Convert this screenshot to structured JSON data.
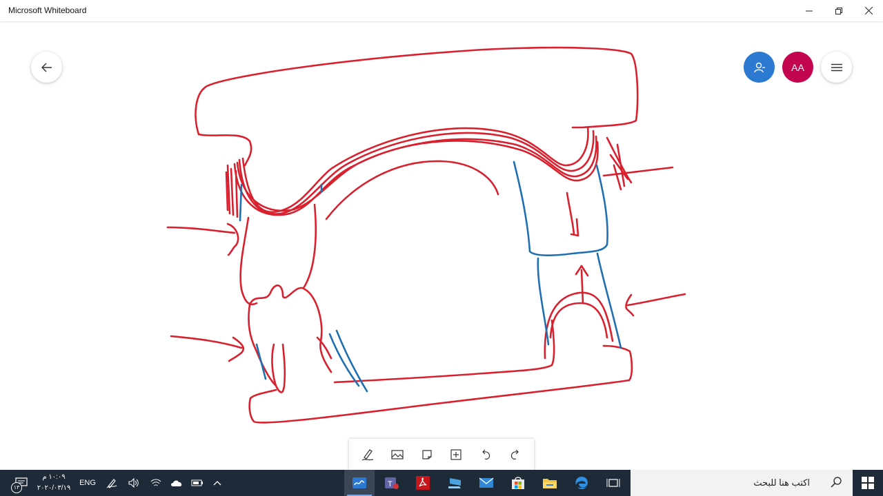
{
  "window": {
    "title": "Microsoft Whiteboard"
  },
  "titlebar_buttons": {
    "minimize": "minimize-icon",
    "restore": "restore-icon",
    "close": "close-icon"
  },
  "header": {
    "avatar_initials": "AA"
  },
  "colors": {
    "ink_red": "#d8202e",
    "ink_blue": "#1f6fb3",
    "avatar": "#c3054f",
    "share": "#2b79d0",
    "taskbar": "#1f2a38"
  },
  "toolbar": {
    "tools": [
      "pen-icon",
      "image-icon",
      "note-icon",
      "add-icon",
      "undo-icon",
      "redo-icon"
    ]
  },
  "taskbar": {
    "time": "١٠:٠٩ م",
    "date": "٢٠٢٠/٠٣/١٩",
    "language": "ENG",
    "notification_count": "١٣",
    "search_placeholder": "اكتب هنا للبحث",
    "apps": [
      "whiteboard",
      "teams",
      "acrobat",
      "connect",
      "mail",
      "store",
      "file-explorer",
      "edge",
      "task-view"
    ]
  }
}
